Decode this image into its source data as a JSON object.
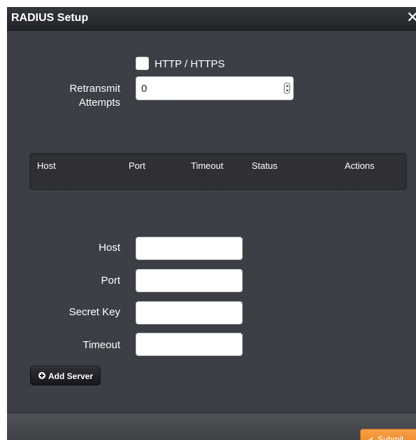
{
  "dialog": {
    "title": "RADIUS Setup",
    "close_icon": "close-icon",
    "close_glyph": "✕"
  },
  "options": {
    "http_https_label": "HTTP / HTTPS",
    "http_https_checked": false
  },
  "retransmit": {
    "label_line1": "Retransmit",
    "label_line2": "Attempts",
    "value": "0"
  },
  "servers_table": {
    "columns": [
      "Host",
      "Port",
      "Timeout",
      "Status",
      "Actions"
    ],
    "rows": []
  },
  "add_form": {
    "host_label": "Host",
    "port_label": "Port",
    "secret_key_label": "Secret Key",
    "timeout_label": "Timeout",
    "host_value": "",
    "port_value": "",
    "secret_key_value": "",
    "timeout_value": ""
  },
  "actions": {
    "add_server_label": "Add Server",
    "add_server_icon": "plus-circle-icon",
    "submit_label": "Submit",
    "submit_icon": "checkmark-icon"
  },
  "colors": {
    "background": "#3b3e45",
    "titlebar": "#26282c",
    "submit_accent": "#f0902e",
    "text": "#ffffff"
  }
}
